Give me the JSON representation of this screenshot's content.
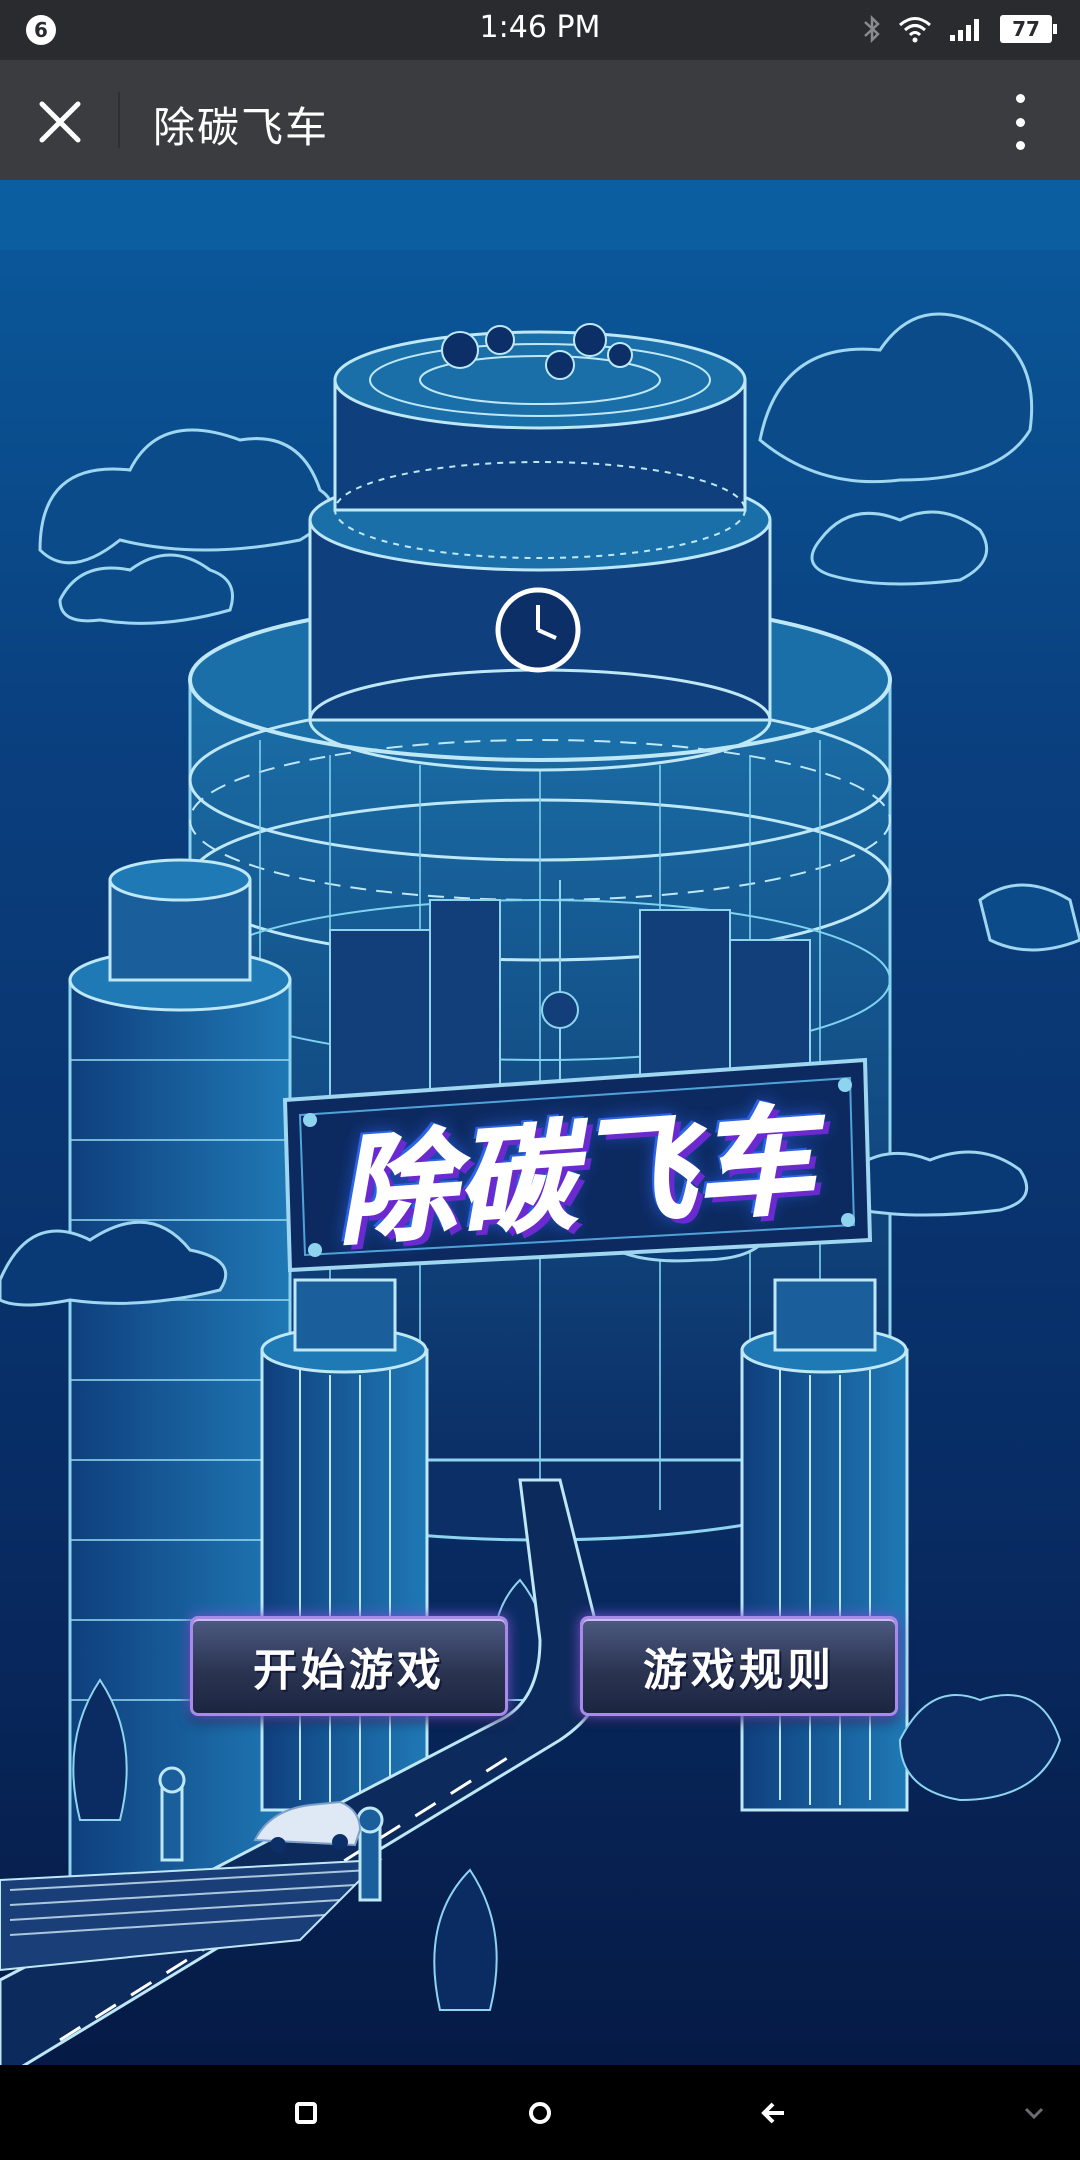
{
  "status_bar": {
    "notification_count": "6",
    "time": "1:46 PM",
    "battery": "77",
    "icons": [
      "bluetooth-icon",
      "wifi-icon",
      "signal-icon",
      "battery-icon"
    ]
  },
  "nav": {
    "title": "除碳飞车",
    "close_icon": "close-icon",
    "more_icon": "more-vertical-icon"
  },
  "game": {
    "logo_text": "除碳飞车",
    "start_button": "开始游戏",
    "rules_button": "游戏规则"
  },
  "system_nav": {
    "icons": [
      "recent-apps-icon",
      "home-icon",
      "back-icon",
      "collapse-icon"
    ]
  },
  "colors": {
    "status_bg": "#2a2b2e",
    "nav_bg": "#3b3c3f",
    "game_top": "#0a5a9c",
    "game_bottom": "#061a45",
    "line_accent": "#7fd3f0",
    "logo_shadow": "#6a2ad0",
    "button_border": "#a88ae8"
  }
}
